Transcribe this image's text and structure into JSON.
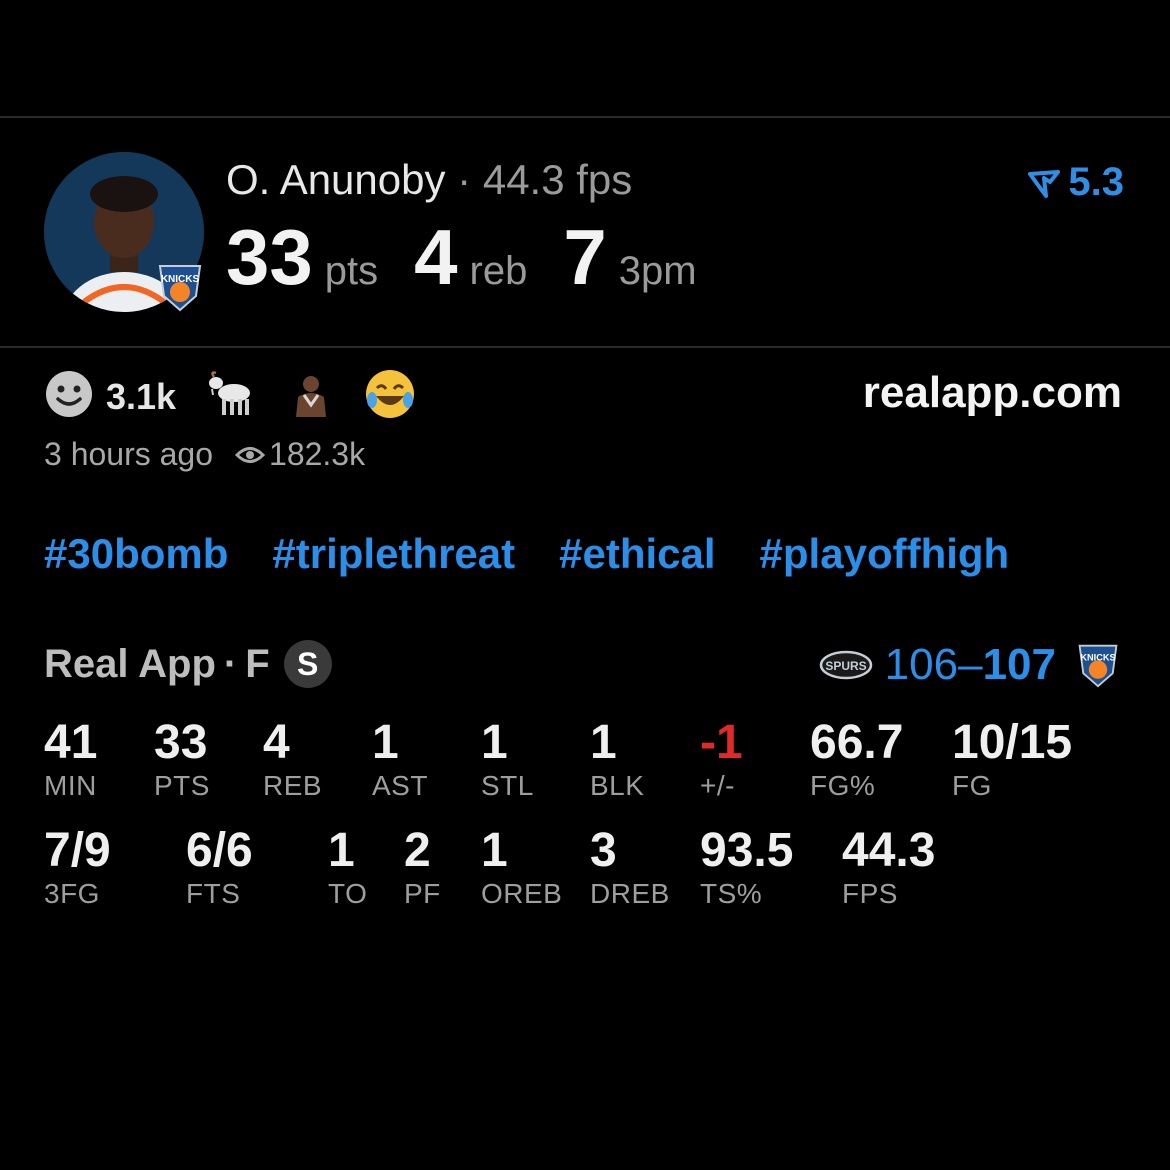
{
  "player": {
    "name": "O. Anunoby",
    "separator": "·",
    "fps": "44.3 fps",
    "rating": "5.3",
    "stats": [
      {
        "value": "33",
        "unit": "pts"
      },
      {
        "value": "4",
        "unit": "reb"
      },
      {
        "value": "7",
        "unit": "3pm"
      }
    ]
  },
  "reactions": {
    "count": "3.1k",
    "icons": [
      "smiley-icon",
      "goat-icon",
      "player-reaction-icon",
      "laughing-crying-icon"
    ]
  },
  "site": "realapp.com",
  "meta": {
    "time": "3 hours ago",
    "views": "182.3k"
  },
  "hashtags": [
    "#30bomb",
    "#triplethreat",
    "#ethical",
    "#playoffhigh"
  ],
  "game": {
    "source": "Real App",
    "separator": "·",
    "status": "F",
    "badge": "S",
    "away_score": "106",
    "dash": "–",
    "home_score": "107"
  },
  "box_score": {
    "row1": [
      {
        "value": "41",
        "label": "MIN"
      },
      {
        "value": "33",
        "label": "PTS"
      },
      {
        "value": "4",
        "label": "REB"
      },
      {
        "value": "1",
        "label": "AST"
      },
      {
        "value": "1",
        "label": "STL"
      },
      {
        "value": "1",
        "label": "BLK"
      },
      {
        "value": "-1",
        "label": "+/-"
      },
      {
        "value": "66.7",
        "label": "FG%"
      },
      {
        "value": "10/15",
        "label": "FG"
      }
    ],
    "row2": [
      {
        "value": "7/9",
        "label": "3FG"
      },
      {
        "value": "6/6",
        "label": "FTS"
      },
      {
        "value": "1",
        "label": "TO"
      },
      {
        "value": "2",
        "label": "PF"
      },
      {
        "value": "1",
        "label": "OREB"
      },
      {
        "value": "3",
        "label": "DREB"
      },
      {
        "value": "93.5",
        "label": "TS%"
      },
      {
        "value": "44.3",
        "label": "FPS"
      }
    ]
  },
  "colors": {
    "accent": "#2b8ee8",
    "negative": "#e02a2a",
    "background": "#000000"
  }
}
